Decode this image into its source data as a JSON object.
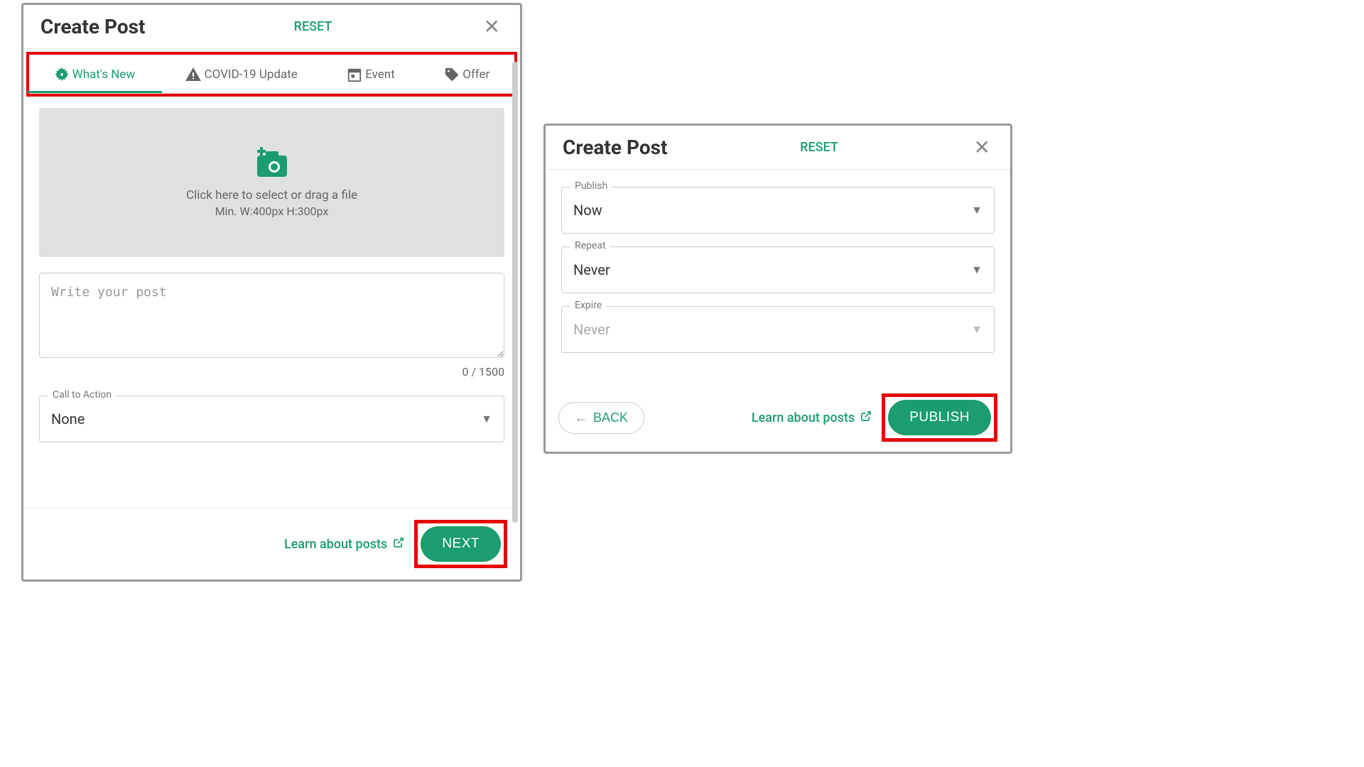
{
  "colors": {
    "accent": "#1b9d6f",
    "highlight": "#e60000"
  },
  "modal1": {
    "title": "Create Post",
    "reset": "RESET",
    "tabs": [
      {
        "label": "What's New"
      },
      {
        "label": "COVID-19 Update"
      },
      {
        "label": "Event"
      },
      {
        "label": "Offer"
      }
    ],
    "upload_line1": "Click here to select or drag a file",
    "upload_line2": "Min. W:400px H:300px",
    "post_placeholder": "Write your post",
    "counter": "0 / 1500",
    "cta": {
      "legend": "Call to Action",
      "value": "None"
    },
    "learn": "Learn about posts",
    "next": "NEXT"
  },
  "modal2": {
    "title": "Create Post",
    "reset": "RESET",
    "publish": {
      "legend": "Publish",
      "value": "Now"
    },
    "repeat": {
      "legend": "Repeat",
      "value": "Never"
    },
    "expire": {
      "legend": "Expire",
      "value": "Never"
    },
    "back": "BACK",
    "learn": "Learn about posts",
    "publish_btn": "PUBLISH"
  }
}
